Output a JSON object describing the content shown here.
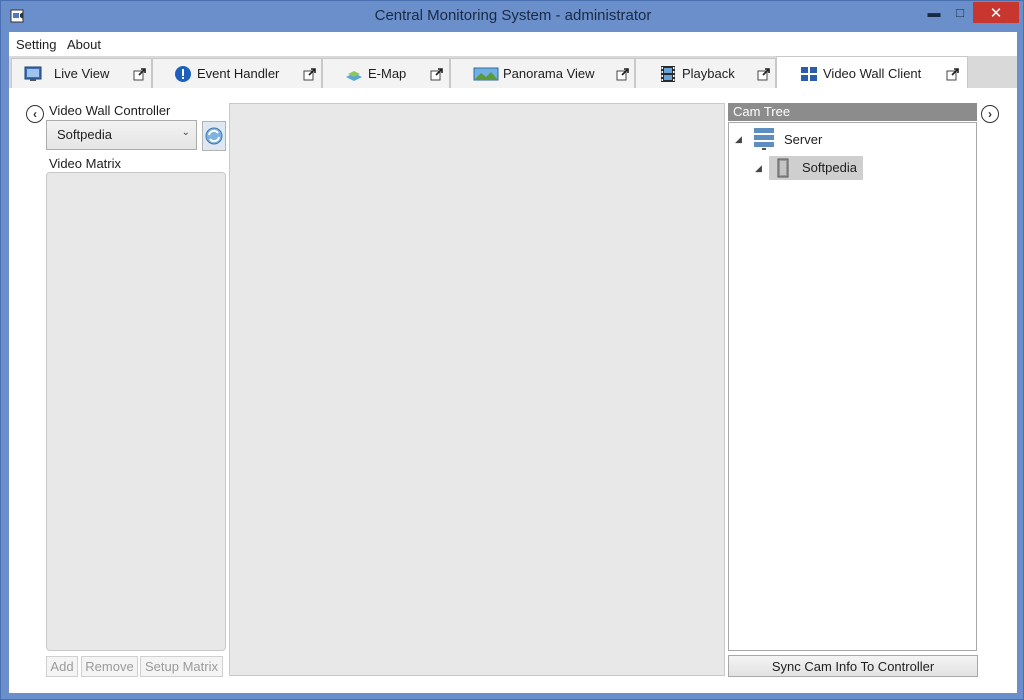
{
  "window": {
    "title": "Central Monitoring System - administrator",
    "minimize_glyph": "▬",
    "maximize_glyph": "□",
    "close_glyph": "✕"
  },
  "menu": {
    "items": [
      "Setting",
      "About"
    ]
  },
  "tabs": [
    {
      "label": "Live View",
      "icon": "live-view-icon"
    },
    {
      "label": "Event Handler",
      "icon": "event-handler-icon"
    },
    {
      "label": "E-Map",
      "icon": "emap-icon"
    },
    {
      "label": "Panorama View",
      "icon": "panorama-icon"
    },
    {
      "label": "Playback",
      "icon": "playback-icon"
    },
    {
      "label": "Video Wall Client",
      "icon": "video-wall-icon",
      "active": true
    }
  ],
  "left_panel": {
    "controller_label": "Video Wall Controller",
    "controller_value": "Softpedia",
    "matrix_label": "Video Matrix",
    "buttons": {
      "add": "Add",
      "remove": "Remove",
      "setup": "Setup Matrix"
    }
  },
  "right_panel": {
    "header": "Cam Tree",
    "tree": {
      "root": "Server",
      "child": "Softpedia"
    },
    "sync_button": "Sync Cam Info To Controller"
  },
  "colors": {
    "frame": "#6b8fcb",
    "close": "#c7372f",
    "panel_gray": "#e8e8e8",
    "header_gray": "#8c8c8c"
  }
}
